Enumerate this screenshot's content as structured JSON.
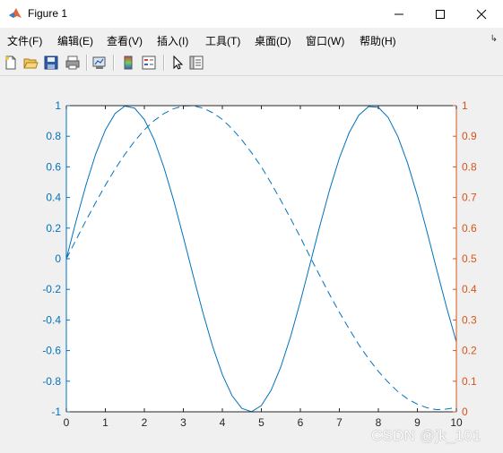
{
  "window": {
    "title": "Figure 1"
  },
  "menu": {
    "items": [
      {
        "label": "文件(F)",
        "id": "file"
      },
      {
        "label": "编辑(E)",
        "id": "edit"
      },
      {
        "label": "查看(V)",
        "id": "view"
      },
      {
        "label": "插入(I)",
        "id": "insert"
      },
      {
        "label": "工具(T)",
        "id": "tools"
      },
      {
        "label": "桌面(D)",
        "id": "desktop"
      },
      {
        "label": "窗口(W)",
        "id": "window"
      },
      {
        "label": "帮助(H)",
        "id": "help"
      }
    ],
    "more_icon": "chevron-right-icon"
  },
  "toolbar": {
    "icons": [
      "new-figure-icon",
      "open-file-icon",
      "save-icon",
      "print-icon",
      "link-plot-icon",
      "insert-colorbar-icon",
      "insert-legend-icon",
      "edit-plot-icon",
      "property-inspector-icon"
    ]
  },
  "watermark": "CSDN @jk_101",
  "chart_data": {
    "type": "line",
    "title": "",
    "xlabel": "",
    "ylabel_left": "",
    "ylabel_right": "",
    "xlim": [
      0,
      10
    ],
    "ylim_left": [
      -1,
      1
    ],
    "ylim_right": [
      0,
      1
    ],
    "x_ticks": [
      "0",
      "1",
      "2",
      "3",
      "4",
      "5",
      "6",
      "7",
      "8",
      "9",
      "10"
    ],
    "y_left_ticks": [
      "-1",
      "-0.8",
      "-0.6",
      "-0.4",
      "-0.2",
      "0",
      "0.2",
      "0.4",
      "0.6",
      "0.8",
      "1"
    ],
    "y_right_ticks": [
      "0",
      "0.1",
      "0.2",
      "0.3",
      "0.4",
      "0.5",
      "0.6",
      "0.7",
      "0.8",
      "0.9",
      "1"
    ],
    "grid": false,
    "colors": {
      "left_axis": "#0072bd",
      "right_axis": "#d95319",
      "line": "#0072bd"
    },
    "series": [
      {
        "axis": "left",
        "style": "solid",
        "x": [
          0,
          0.25,
          0.5,
          0.75,
          1,
          1.25,
          1.5,
          1.75,
          2,
          2.25,
          2.5,
          2.75,
          3,
          3.25,
          3.5,
          3.75,
          4,
          4.25,
          4.5,
          4.75,
          5,
          5.25,
          5.5,
          5.75,
          6,
          6.25,
          6.5,
          6.75,
          7,
          7.25,
          7.5,
          7.75,
          8,
          8.25,
          8.5,
          8.75,
          9,
          9.25,
          9.5,
          9.75,
          10
        ],
        "y": [
          0,
          0.247,
          0.479,
          0.682,
          0.841,
          0.949,
          0.997,
          0.984,
          0.909,
          0.778,
          0.598,
          0.382,
          0.141,
          -0.108,
          -0.351,
          -0.572,
          -0.757,
          -0.895,
          -0.978,
          -0.999,
          -0.959,
          -0.859,
          -0.706,
          -0.508,
          -0.279,
          -0.033,
          0.215,
          0.45,
          0.657,
          0.823,
          0.938,
          0.994,
          0.989,
          0.923,
          0.798,
          0.624,
          0.412,
          0.174,
          -0.075,
          -0.319,
          -0.544
        ]
      },
      {
        "axis": "right",
        "style": "dashed",
        "x": [
          0,
          0.25,
          0.5,
          0.75,
          1,
          1.25,
          1.5,
          1.75,
          2,
          2.25,
          2.5,
          2.75,
          3,
          3.25,
          3.5,
          3.75,
          4,
          4.25,
          4.5,
          4.75,
          5,
          5.25,
          5.5,
          5.75,
          6,
          6.25,
          6.5,
          6.75,
          7,
          7.25,
          7.5,
          7.75,
          8,
          8.25,
          8.5,
          8.75,
          9,
          9.25,
          9.5,
          9.75,
          10
        ],
        "y": [
          0.5,
          0.562,
          0.624,
          0.683,
          0.74,
          0.793,
          0.841,
          0.884,
          0.921,
          0.951,
          0.974,
          0.99,
          0.999,
          1.0,
          0.992,
          0.977,
          0.955,
          0.924,
          0.888,
          0.846,
          0.8,
          0.747,
          0.69,
          0.631,
          0.57,
          0.506,
          0.444,
          0.383,
          0.325,
          0.271,
          0.219,
          0.173,
          0.132,
          0.097,
          0.066,
          0.042,
          0.025,
          0.013,
          0.007,
          0.009,
          0.014
        ]
      }
    ]
  }
}
